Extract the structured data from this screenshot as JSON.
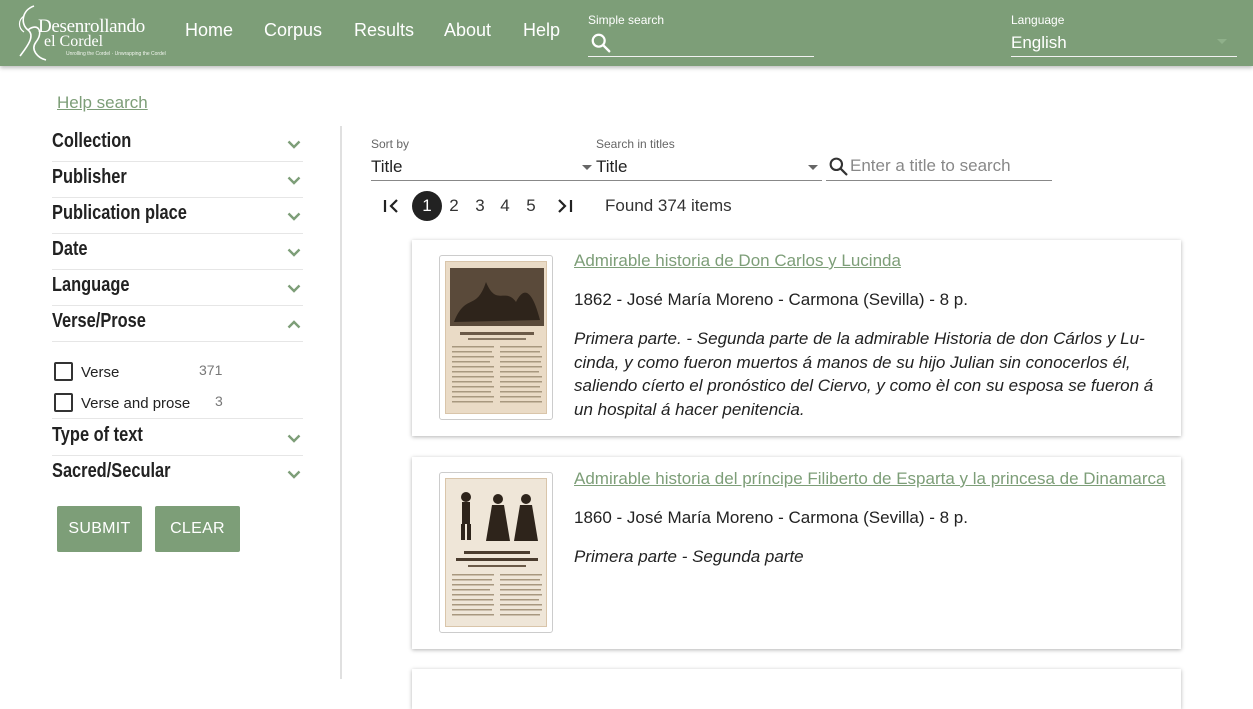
{
  "header": {
    "logo_line1": "Desenrollando",
    "logo_line2": "el Cordel",
    "logo_tagline": "Unrolling the Cordel · Unwrapping the Cordel",
    "nav": [
      "Home",
      "Corpus",
      "Results",
      "About",
      "Help"
    ],
    "simple_search_label": "Simple search",
    "language_label": "Language",
    "language_value": "English"
  },
  "sidebar": {
    "help_search": "Help search",
    "facets": [
      {
        "label": "Collection",
        "expanded": false
      },
      {
        "label": "Publisher",
        "expanded": false
      },
      {
        "label": "Publication place",
        "expanded": false
      },
      {
        "label": "Date",
        "expanded": false
      },
      {
        "label": "Language",
        "expanded": false
      },
      {
        "label": "Verse/Prose",
        "expanded": true
      },
      {
        "label": "Type of text",
        "expanded": false
      },
      {
        "label": "Sacred/Secular",
        "expanded": false
      }
    ],
    "verse_prose_options": [
      {
        "label": "Verse",
        "count": "371",
        "checked": false
      },
      {
        "label": "Verse and prose",
        "count": "3",
        "checked": false
      }
    ],
    "submit": "SUBMIT",
    "clear": "CLEAR"
  },
  "controls": {
    "sort_label": "Sort by",
    "sort_value": "Title",
    "search_in_label": "Search in titles",
    "search_in_value": "Title",
    "title_search_placeholder": "Enter a title to search"
  },
  "pagination": {
    "pages": [
      "1",
      "2",
      "3",
      "4",
      "5"
    ],
    "current": "1",
    "found": "Found 374 items"
  },
  "results": [
    {
      "title": "Admirable historia de Don Carlos y Lucinda",
      "meta": "1862 - José María Moreno - Carmona (Sevilla) - 8 p.",
      "description": "Primera parte. - Segunda parte de la admirable Historia de don Cárlos y Lu-cinda, y como fueron muertos á manos de su hijo Julian sin conocerlos él, saliendo cíerto el pronóstico del Ciervo, y como èl con su esposa se fueron á un hospital á hacer penitencia."
    },
    {
      "title": "Admirable historia del príncipe Filiberto de Esparta y la princesa de Dinamarca",
      "meta": "1860 - José María Moreno - Carmona (Sevilla) - 8 p.",
      "description": "Primera parte - Segunda parte"
    }
  ],
  "colors": {
    "brand": "#7d9e78",
    "text": "#222222"
  }
}
